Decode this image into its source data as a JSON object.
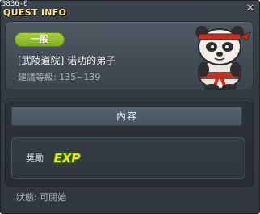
{
  "window": {
    "quest_id": "3836-0",
    "title": "QUEST INFO",
    "close_icon": "close-icon"
  },
  "quest": {
    "category_badge": "一般",
    "name": "[武陵道院] 诺功的弟子",
    "level_label": "建議等級:",
    "level_range": "135~139",
    "npc_icon": "panda-npc-icon"
  },
  "content": {
    "header": "內容",
    "reward_label": "獎勵",
    "reward_icon_text": "EXP"
  },
  "status": {
    "label": "狀態:",
    "value": "可開始"
  },
  "colors": {
    "badge_green": "#8fbf27",
    "title_yellow": "#ffe68a",
    "exp_yellow": "#ffe400",
    "exp_green": "#39b43a"
  }
}
